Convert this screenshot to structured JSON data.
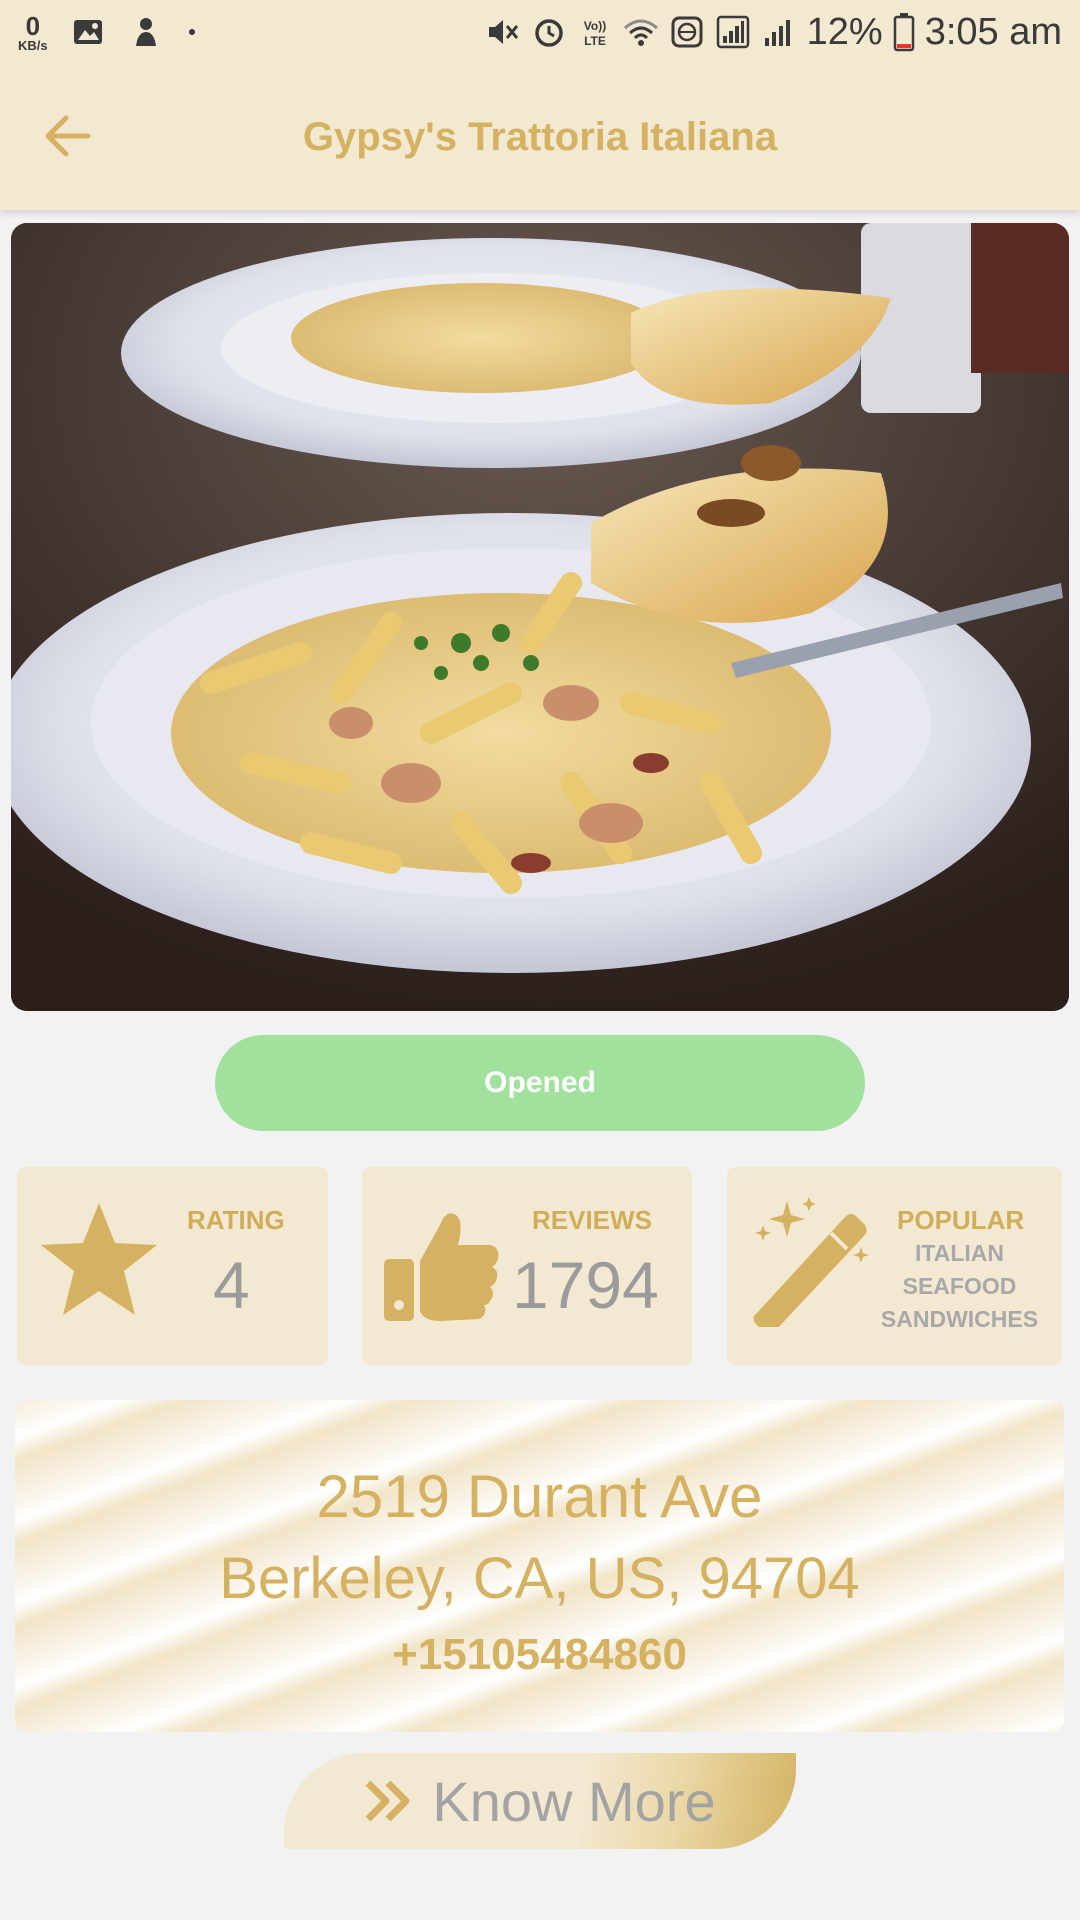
{
  "status_bar": {
    "kb_value": "0",
    "kb_unit": "KB/s",
    "battery_percent": "12%",
    "time": "3:05 am",
    "icons": [
      "image-icon",
      "app-icon",
      "dot-icon",
      "mute-icon",
      "alarm-icon",
      "volte-icon",
      "wifi-icon",
      "vpn-icon",
      "sim-signal-icon",
      "signal-icon",
      "battery-icon"
    ]
  },
  "appbar": {
    "title": "Gypsy's Trattoria Italiana",
    "back_icon": "arrow-left-icon"
  },
  "carousel": {
    "image_alt": "Penne pasta with chicken, parsley and garlic bread",
    "page_count": 3,
    "active_index": 2
  },
  "status": {
    "label": "Opened",
    "color": "#a1e09d"
  },
  "cards": {
    "rating": {
      "label": "RATING",
      "value": "4",
      "icon": "star-icon"
    },
    "reviews": {
      "label": "REVIEWS",
      "value": "1794",
      "icon": "thumbs-up-icon"
    },
    "popular": {
      "label": "POPULAR",
      "items": [
        "ITALIAN",
        "SEAFOOD",
        "SANDWICHES"
      ],
      "icon": "magic-wand-icon"
    }
  },
  "address": {
    "line1": "2519 Durant Ave",
    "line2": "Berkeley, CA, US, 94704",
    "phone": "+15105484860"
  },
  "cta": {
    "label": "Know More",
    "icon": "double-chevron-right-icon"
  },
  "colors": {
    "accent": "#d4b262",
    "surface": "#f3e8d1",
    "background": "#f2f2f2"
  }
}
